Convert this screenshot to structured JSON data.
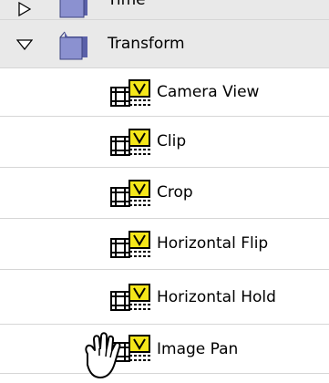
{
  "tree": {
    "folders": [
      {
        "label": "Time",
        "icon": "folder-icon",
        "expanded": false
      },
      {
        "label": "Transform",
        "icon": "folder-icon",
        "expanded": true
      }
    ],
    "transform_items": [
      {
        "label": "Camera View",
        "icon": "effect-icon"
      },
      {
        "label": "Clip",
        "icon": "effect-icon"
      },
      {
        "label": "Crop",
        "icon": "effect-icon"
      },
      {
        "label": "Horizontal Flip",
        "icon": "effect-icon"
      },
      {
        "label": "Horizontal Hold",
        "icon": "effect-icon"
      },
      {
        "label": "Image Pan",
        "icon": "effect-icon"
      }
    ]
  },
  "colors": {
    "folder_row_bg": "#e9e9e9",
    "separator": "#d6d6d6",
    "folder_blue": "#7f86c8",
    "effect_yellow": "#f4e61a"
  },
  "cursor": {
    "icon": "hand-cursor-icon"
  }
}
